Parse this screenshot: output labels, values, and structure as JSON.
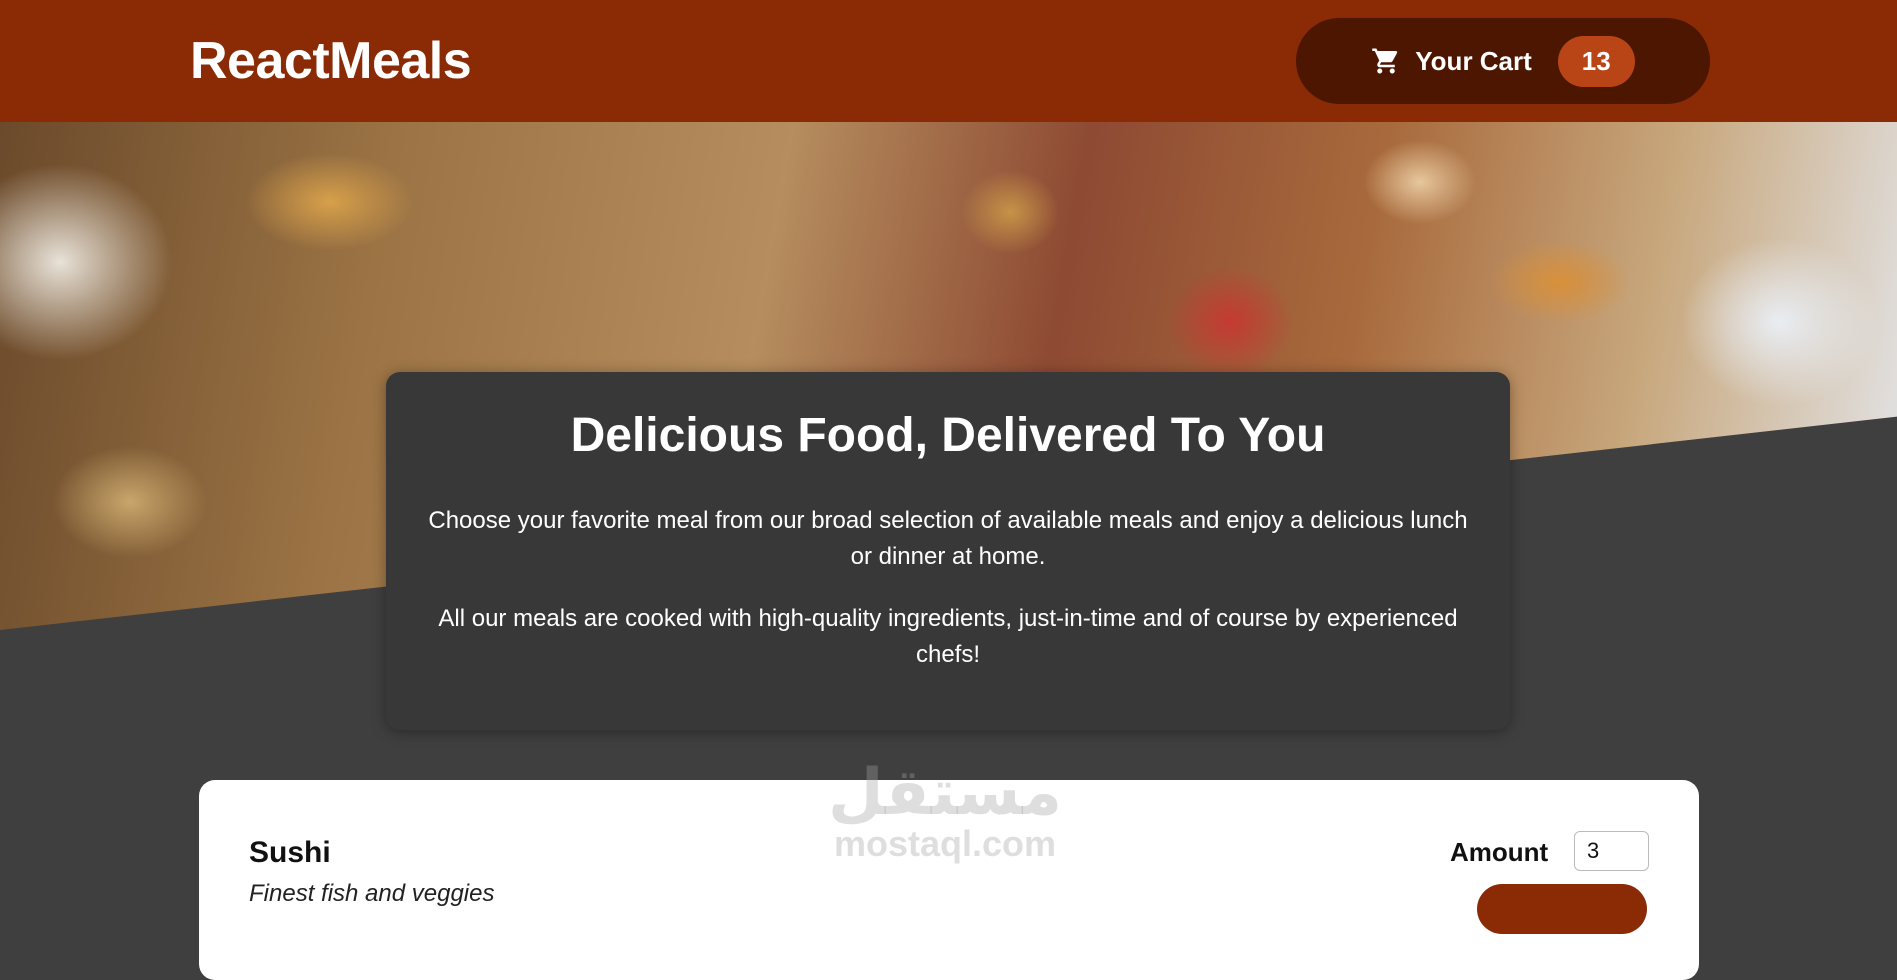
{
  "header": {
    "logo": "ReactMeals",
    "cart": {
      "icon": "cart-icon",
      "label": "Your Cart",
      "count": "13"
    }
  },
  "colors": {
    "header_bg": "#8a2b06",
    "cart_button_bg": "#4d1601",
    "badge_bg": "#b94517",
    "page_bg": "#3f3f3f",
    "summary_bg": "#383838"
  },
  "summary": {
    "title": "Delicious Food, Delivered To You",
    "paragraph_1": "Choose your favorite meal from our broad selection of available meals and enjoy a delicious lunch or dinner at home.",
    "paragraph_2": "All our meals are cooked with high-quality ingredients, just-in-time and of course by experienced chefs!"
  },
  "meals": [
    {
      "name": "Sushi",
      "description": "Finest fish and veggies",
      "amount_label": "Amount",
      "amount_value": "3"
    }
  ],
  "watermark": {
    "arabic": "مستقل",
    "latin": "mostaql.com"
  }
}
